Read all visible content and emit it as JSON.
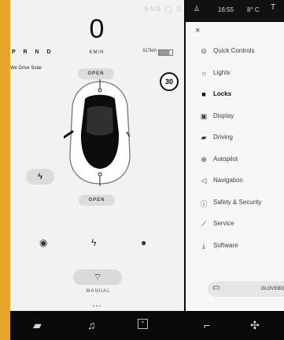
{
  "status": {
    "top_status": "SNS ◯ D",
    "time": "16:55",
    "temp": "8° C",
    "gear": "P R N D"
  },
  "speed": {
    "value": "0",
    "unit": "KM/H"
  },
  "range": "317km",
  "caption": "We Drive Solar",
  "speed_limit": "30",
  "car": {
    "front_label": "OPEN",
    "rear_label": "OPEN",
    "charge_icon": "lightning-icon"
  },
  "quick_controls": [
    {
      "icon": "camera-icon"
    },
    {
      "icon": "lightning-icon"
    },
    {
      "icon": "microphone-icon"
    }
  ],
  "wiper": {
    "label": "MANUAL",
    "icon": "wiper-icon"
  },
  "menu": {
    "close": "×",
    "items": [
      {
        "label": "Quick Controls",
        "icon": "toggle-icon",
        "active": false
      },
      {
        "label": "Lights",
        "icon": "light-icon",
        "active": false
      },
      {
        "label": "Locks",
        "icon": "lock-icon",
        "active": true
      },
      {
        "label": "Display",
        "icon": "display-icon",
        "active": false
      },
      {
        "label": "Driving",
        "icon": "car-icon",
        "active": false
      },
      {
        "label": "Autopilot",
        "icon": "steering-icon",
        "active": false
      },
      {
        "label": "Navigation",
        "icon": "navigation-icon",
        "active": false
      },
      {
        "label": "Safety & Security",
        "icon": "shield-icon",
        "active": false
      },
      {
        "label": "Service",
        "icon": "wrench-icon",
        "active": false
      },
      {
        "label": "Software",
        "icon": "download-icon",
        "active": false
      }
    ]
  },
  "glovebox": "GLOVEBOX",
  "nav": [
    {
      "icon": "car-icon"
    },
    {
      "icon": "music-icon"
    },
    {
      "icon": "app-icon"
    },
    {
      "icon": "seat-icon"
    },
    {
      "icon": "fan-icon"
    }
  ]
}
